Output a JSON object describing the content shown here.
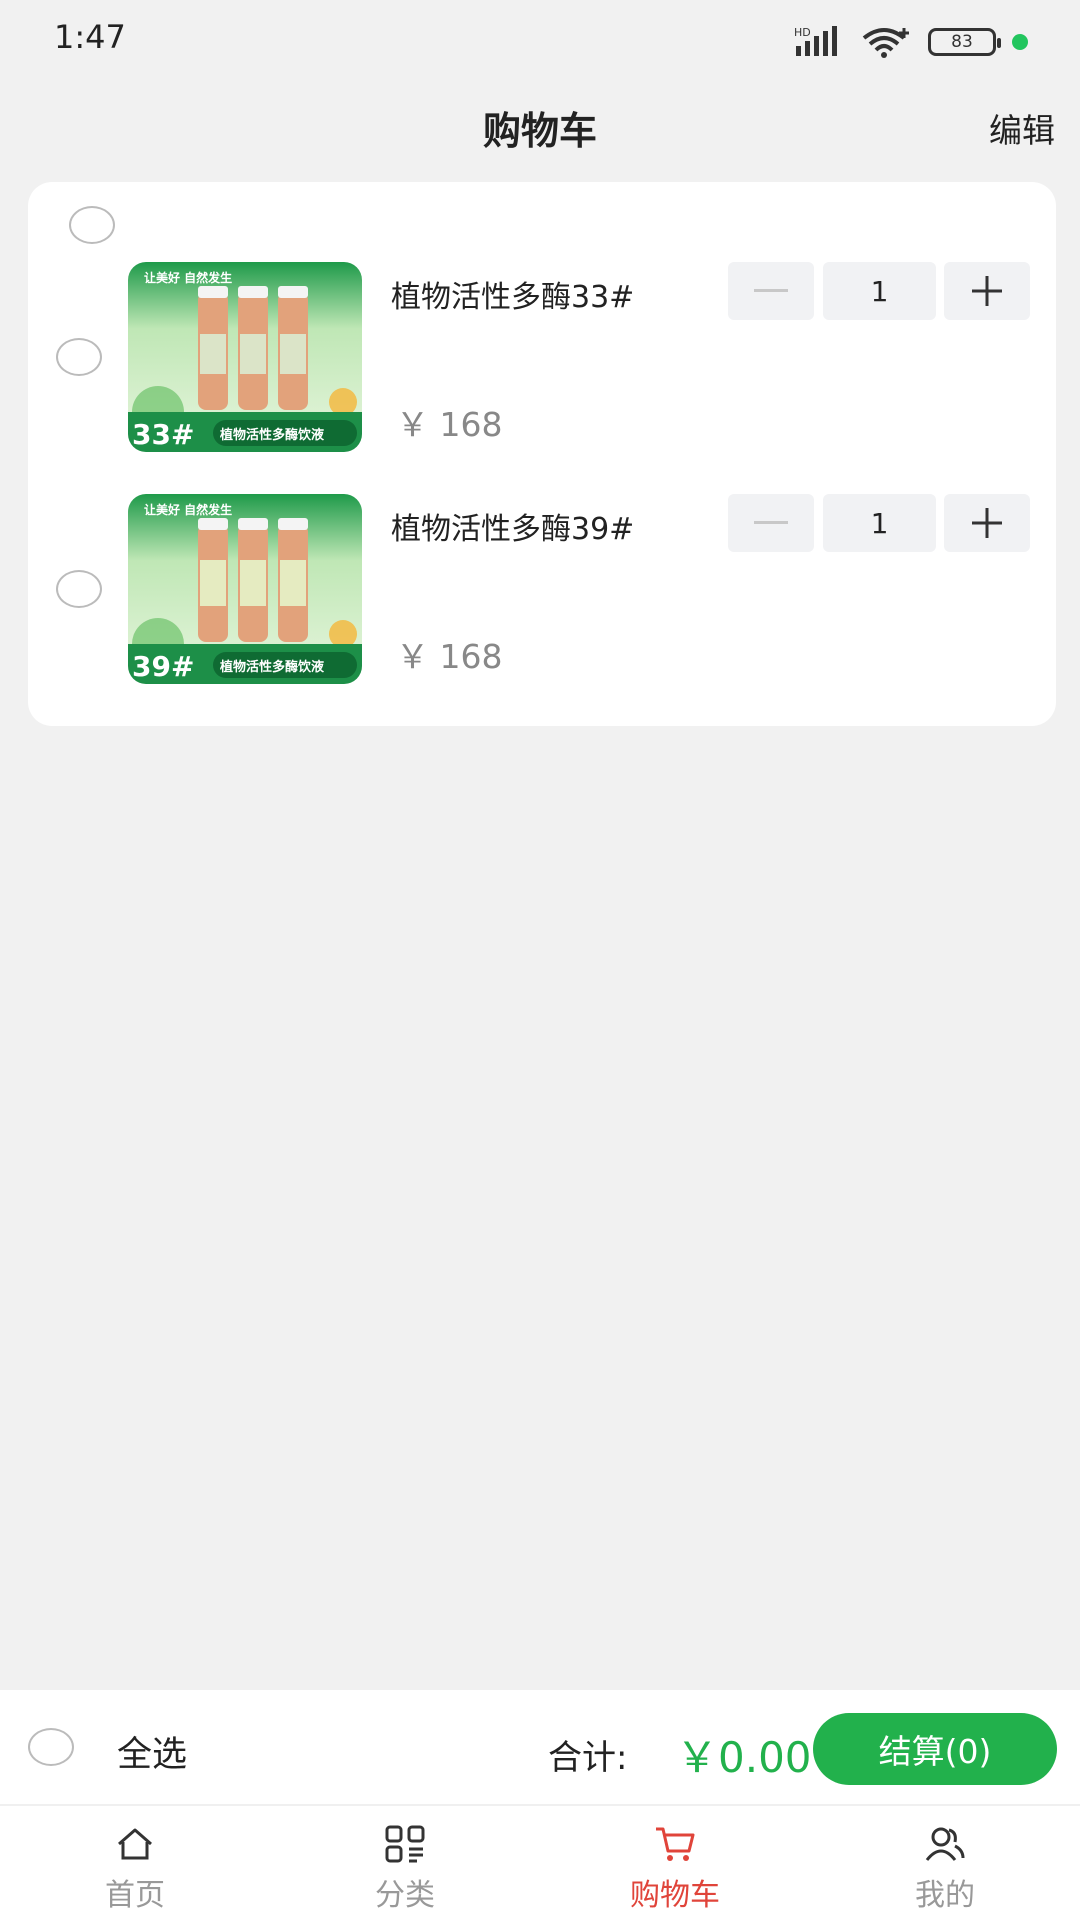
{
  "status_bar": {
    "time": "1:47",
    "battery": "83",
    "network_label": "HD"
  },
  "header": {
    "title": "购物车",
    "edit_label": "编辑"
  },
  "cart": {
    "items": [
      {
        "title": "植物活性多酶33#",
        "price": "￥ 168",
        "quantity": "1",
        "image_badge": "33#",
        "image_slogan": "让美好 自然发生",
        "image_caption": "植物活性多酶饮液"
      },
      {
        "title": "植物活性多酶39#",
        "price": "￥ 168",
        "quantity": "1",
        "image_badge": "39#",
        "image_slogan": "让美好 自然发生",
        "image_caption": "植物活性多酶饮液"
      }
    ]
  },
  "footer": {
    "select_all_label": "全选",
    "total_label": "合计:",
    "total_amount": "￥0.00",
    "checkout_label": "结算(0)"
  },
  "tabs": [
    {
      "label": "首页",
      "icon": "home-icon"
    },
    {
      "label": "分类",
      "icon": "category-icon"
    },
    {
      "label": "购物车",
      "icon": "cart-icon"
    },
    {
      "label": "我的",
      "icon": "profile-icon"
    }
  ],
  "colors": {
    "accent_green": "#22b14c",
    "active_tab_red": "#e0443a",
    "background": "#f1f1f1"
  }
}
